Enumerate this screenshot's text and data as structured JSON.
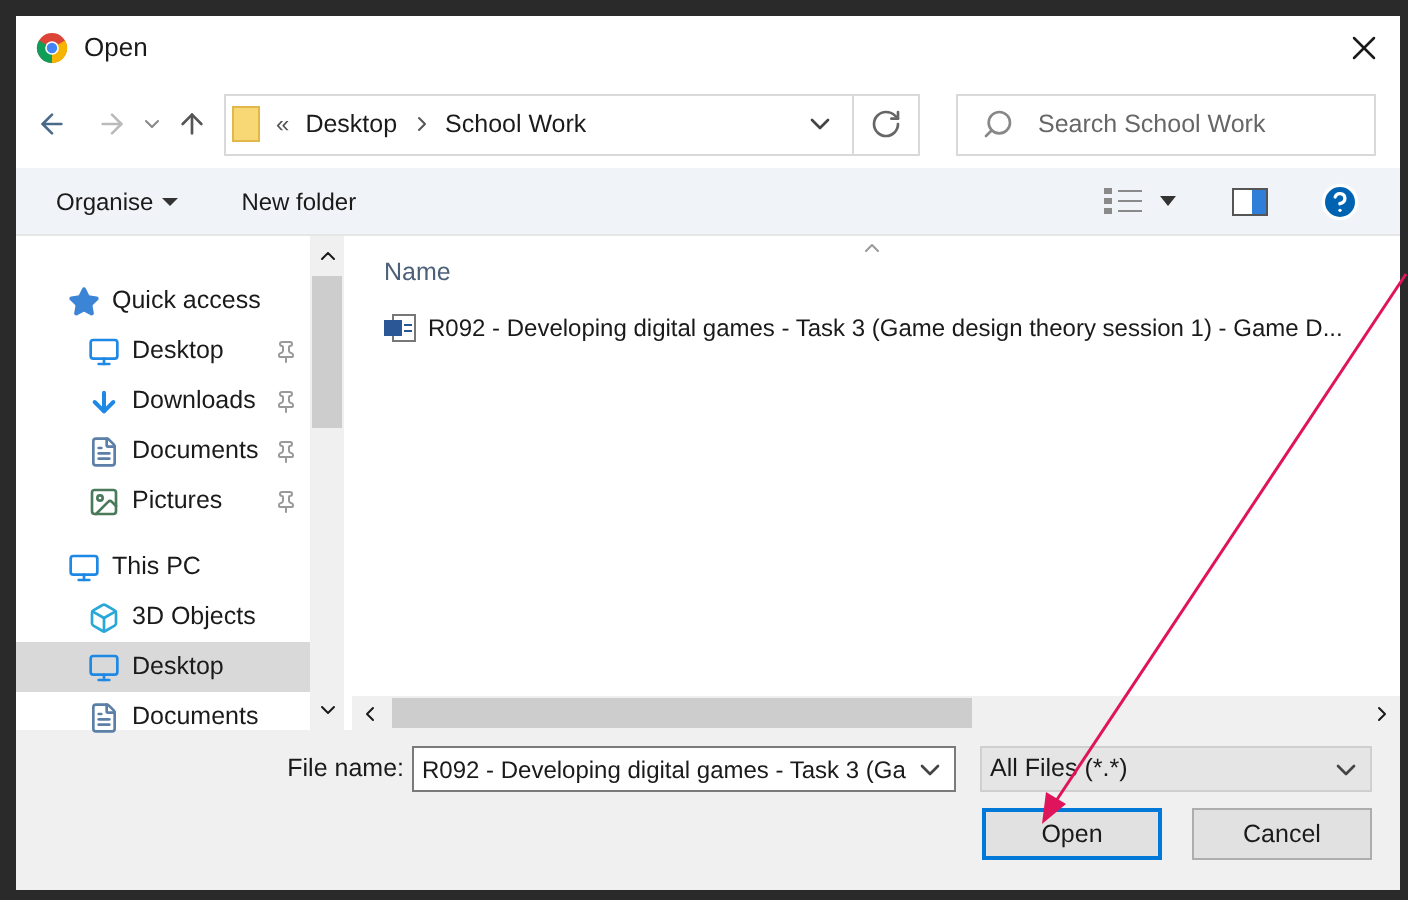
{
  "window": {
    "title": "Open"
  },
  "address": {
    "overflow": "«",
    "crumbs": [
      "Desktop",
      "School Work"
    ]
  },
  "search": {
    "placeholder": "Search School Work"
  },
  "toolbar": {
    "organise": "Organise",
    "new_folder": "New folder"
  },
  "sidebar": {
    "items": [
      {
        "label": "Quick access",
        "selected": false,
        "children": [
          {
            "label": "Desktop",
            "pinned": true,
            "selected": false
          },
          {
            "label": "Downloads",
            "pinned": true,
            "selected": false
          },
          {
            "label": "Documents",
            "pinned": true,
            "selected": false
          },
          {
            "label": "Pictures",
            "pinned": true,
            "selected": false
          }
        ]
      },
      {
        "label": "This PC",
        "selected": false,
        "children": [
          {
            "label": "3D Objects",
            "pinned": false,
            "selected": false
          },
          {
            "label": "Desktop",
            "pinned": false,
            "selected": true
          },
          {
            "label": "Documents",
            "pinned": false,
            "selected": false
          }
        ]
      }
    ]
  },
  "table": {
    "columns": [
      "Name"
    ],
    "rows": [
      {
        "name": "R092 - Developing digital games - Task 3 (Game design theory session 1) - Game D..."
      }
    ]
  },
  "file_name": {
    "label": "File name:",
    "value": "R092 - Developing digital games - Task 3 (Ga"
  },
  "file_type": {
    "value": "All Files (*.*)"
  },
  "buttons": [
    {
      "label": "Open",
      "selected": true
    },
    {
      "label": "Cancel",
      "selected": false
    }
  ]
}
